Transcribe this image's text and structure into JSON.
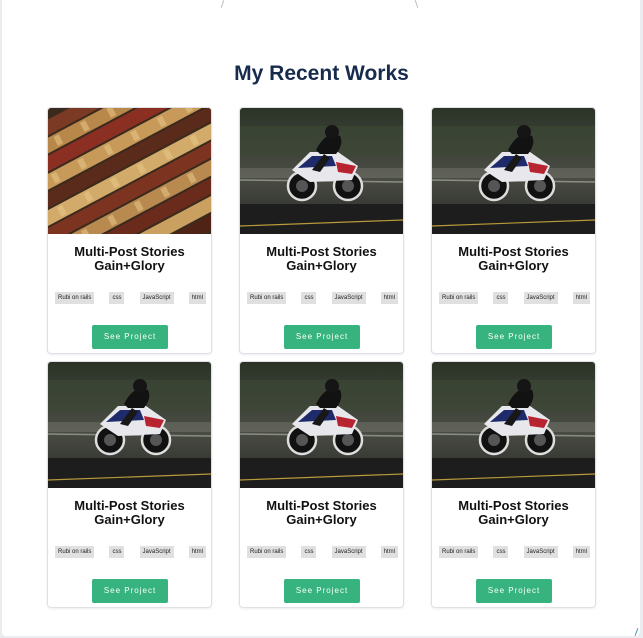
{
  "section_title": "My Recent Works",
  "projects": [
    {
      "title_line1": "Multi-Post Stories",
      "title_line2": "Gain+Glory",
      "image": "books-photo",
      "tags": [
        "Rubi on rails",
        "css",
        "JavaScript",
        "html"
      ],
      "button": "See Project"
    },
    {
      "title_line1": "Multi-Post Stories",
      "title_line2": "Gain+Glory",
      "image": "motorcycle-photo",
      "tags": [
        "Rubi on rails",
        "css",
        "JavaScript",
        "html"
      ],
      "button": "See Project"
    },
    {
      "title_line1": "Multi-Post Stories",
      "title_line2": "Gain+Glory",
      "image": "motorcycle-photo",
      "tags": [
        "Rubi on rails",
        "css",
        "JavaScript",
        "html"
      ],
      "button": "See Project"
    },
    {
      "title_line1": "Multi-Post Stories",
      "title_line2": "Gain+Glory",
      "image": "motorcycle-photo",
      "tags": [
        "Rubi on rails",
        "css",
        "JavaScript",
        "html"
      ],
      "button": "See Project"
    },
    {
      "title_line1": "Multi-Post Stories",
      "title_line2": "Gain+Glory",
      "image": "motorcycle-photo",
      "tags": [
        "Rubi on rails",
        "css",
        "JavaScript",
        "html"
      ],
      "button": "See Project"
    },
    {
      "title_line1": "Multi-Post Stories",
      "title_line2": "Gain+Glory",
      "image": "motorcycle-photo",
      "tags": [
        "Rubi on rails",
        "css",
        "JavaScript",
        "html"
      ],
      "button": "See Project"
    }
  ],
  "colors": {
    "title": "#172b4d",
    "button": "#36b37e",
    "tag_bg": "#e0e0e0"
  }
}
